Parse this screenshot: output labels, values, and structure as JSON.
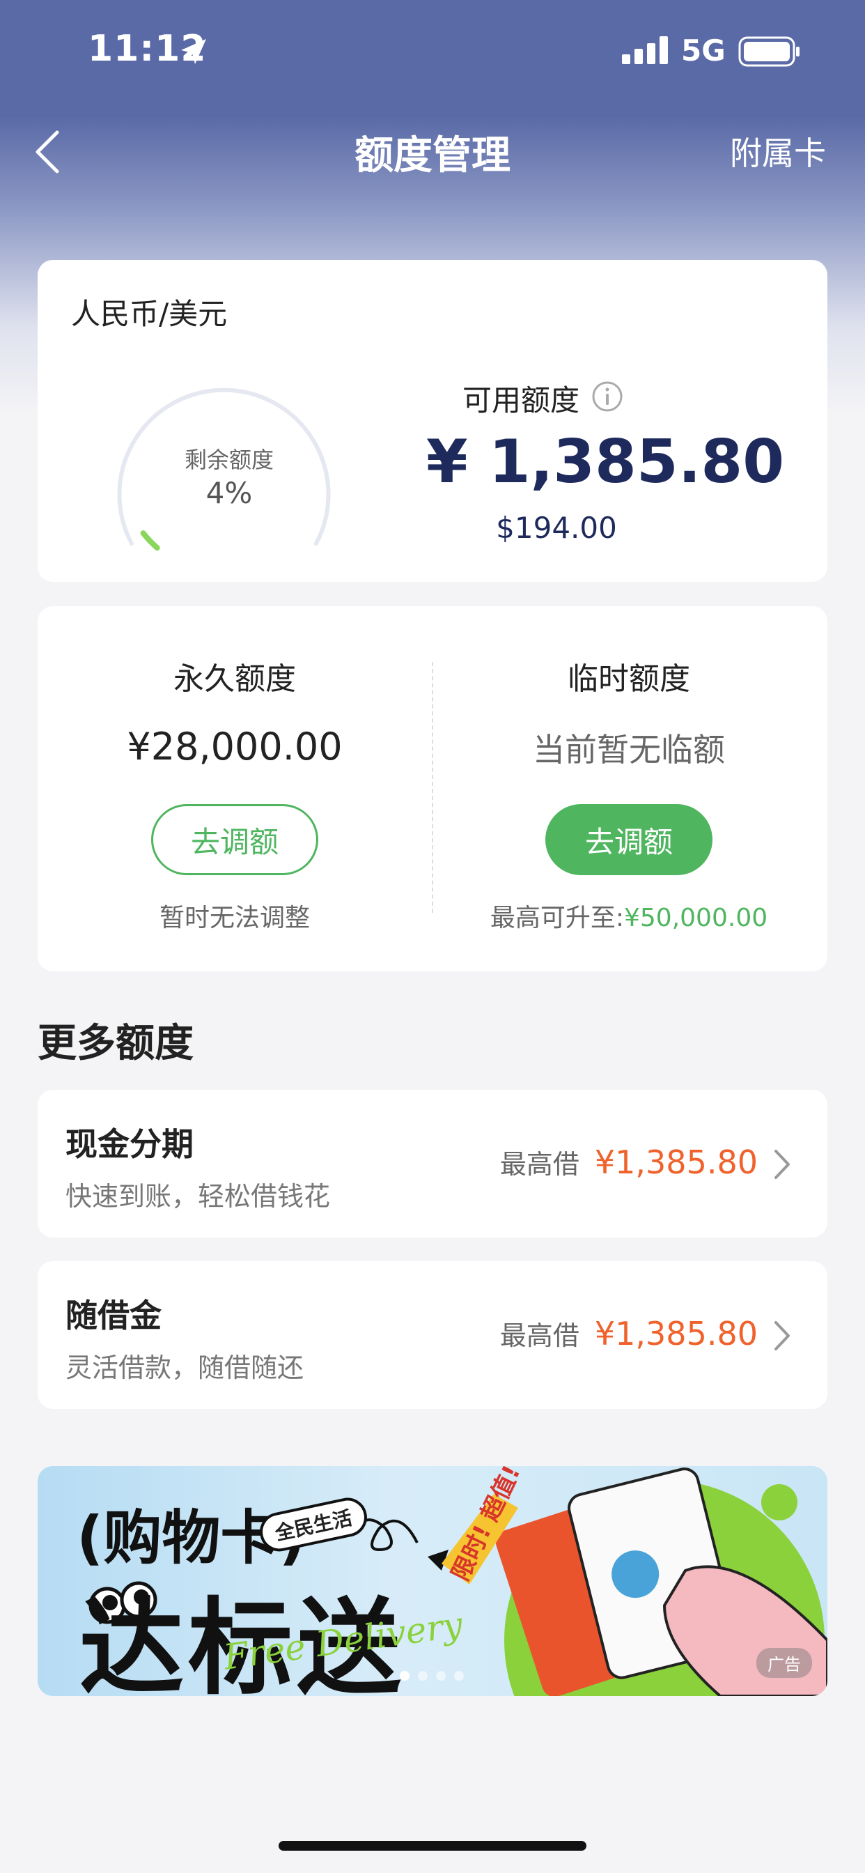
{
  "status_bar": {
    "time": "11:12",
    "network": "5G"
  },
  "nav": {
    "title": "额度管理",
    "right_label": "附属卡"
  },
  "summary": {
    "currency_label": "人民币/美元",
    "gauge_title": "剩余额度",
    "gauge_percent": "4%",
    "gauge_fraction": 0.04,
    "available_label": "可用额度",
    "available_cny": "¥ 1,385.80",
    "available_usd": "$194.00"
  },
  "limits": {
    "permanent": {
      "title": "永久额度",
      "value": "¥28,000.00",
      "button": "去调额",
      "note": "暂时无法调整"
    },
    "temporary": {
      "title": "临时额度",
      "value": "当前暂无临额",
      "button": "去调额",
      "note_label": "最高可升至:",
      "note_value": "¥50,000.00"
    }
  },
  "more": {
    "title": "更多额度",
    "items": [
      {
        "title": "现金分期",
        "subtitle": "快速到账，轻松借钱花",
        "right_label": "最高借",
        "amount": "¥1,385.80"
      },
      {
        "title": "随借金",
        "subtitle": "灵活借款，随借随还",
        "right_label": "最高借",
        "amount": "¥1,385.80"
      }
    ]
  },
  "banner": {
    "line1": "(购物卡)",
    "line2": "达标送",
    "badge": "全民生活",
    "script": "Free Delivery",
    "tag": "限时! 超值!",
    "ad_label": "广告",
    "dots_count": 4,
    "active_dot": 0
  },
  "colors": {
    "header": "#5a6aa6",
    "green": "#4fb55f",
    "orange": "#f0622b",
    "navy": "#1e2a5c"
  }
}
